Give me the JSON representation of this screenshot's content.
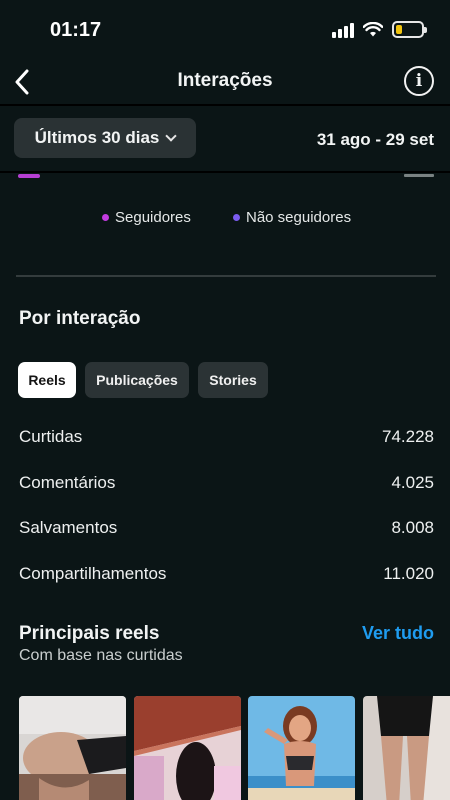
{
  "status_bar": {
    "time": "01:17",
    "battery_level": 0.25
  },
  "nav": {
    "title": "Interações"
  },
  "filters": {
    "period": "Últimos 30 dias",
    "date_range": "31 ago - 29 set"
  },
  "legend": [
    {
      "label": "Seguidores",
      "color": "#c23be0"
    },
    {
      "label": "Não seguidores",
      "color": "#7b5cf0"
    }
  ],
  "by_interaction": {
    "title": "Por interação",
    "tabs": [
      {
        "label": "Reels",
        "active": true
      },
      {
        "label": "Publicações",
        "active": false
      },
      {
        "label": "Stories",
        "active": false
      }
    ],
    "metrics": [
      {
        "label": "Curtidas",
        "value": "74.228"
      },
      {
        "label": "Comentários",
        "value": "4.025"
      },
      {
        "label": "Salvamentos",
        "value": "8.008"
      },
      {
        "label": "Compartilhamentos",
        "value": "11.020"
      }
    ]
  },
  "top_reels": {
    "title": "Principais reels",
    "subtitle": "Com base nas curtidas",
    "see_all": "Ver tudo",
    "count": 4
  },
  "colors": {
    "background": "#0b1516",
    "accent": "#1f9cf0",
    "chip": "#2b3335"
  }
}
